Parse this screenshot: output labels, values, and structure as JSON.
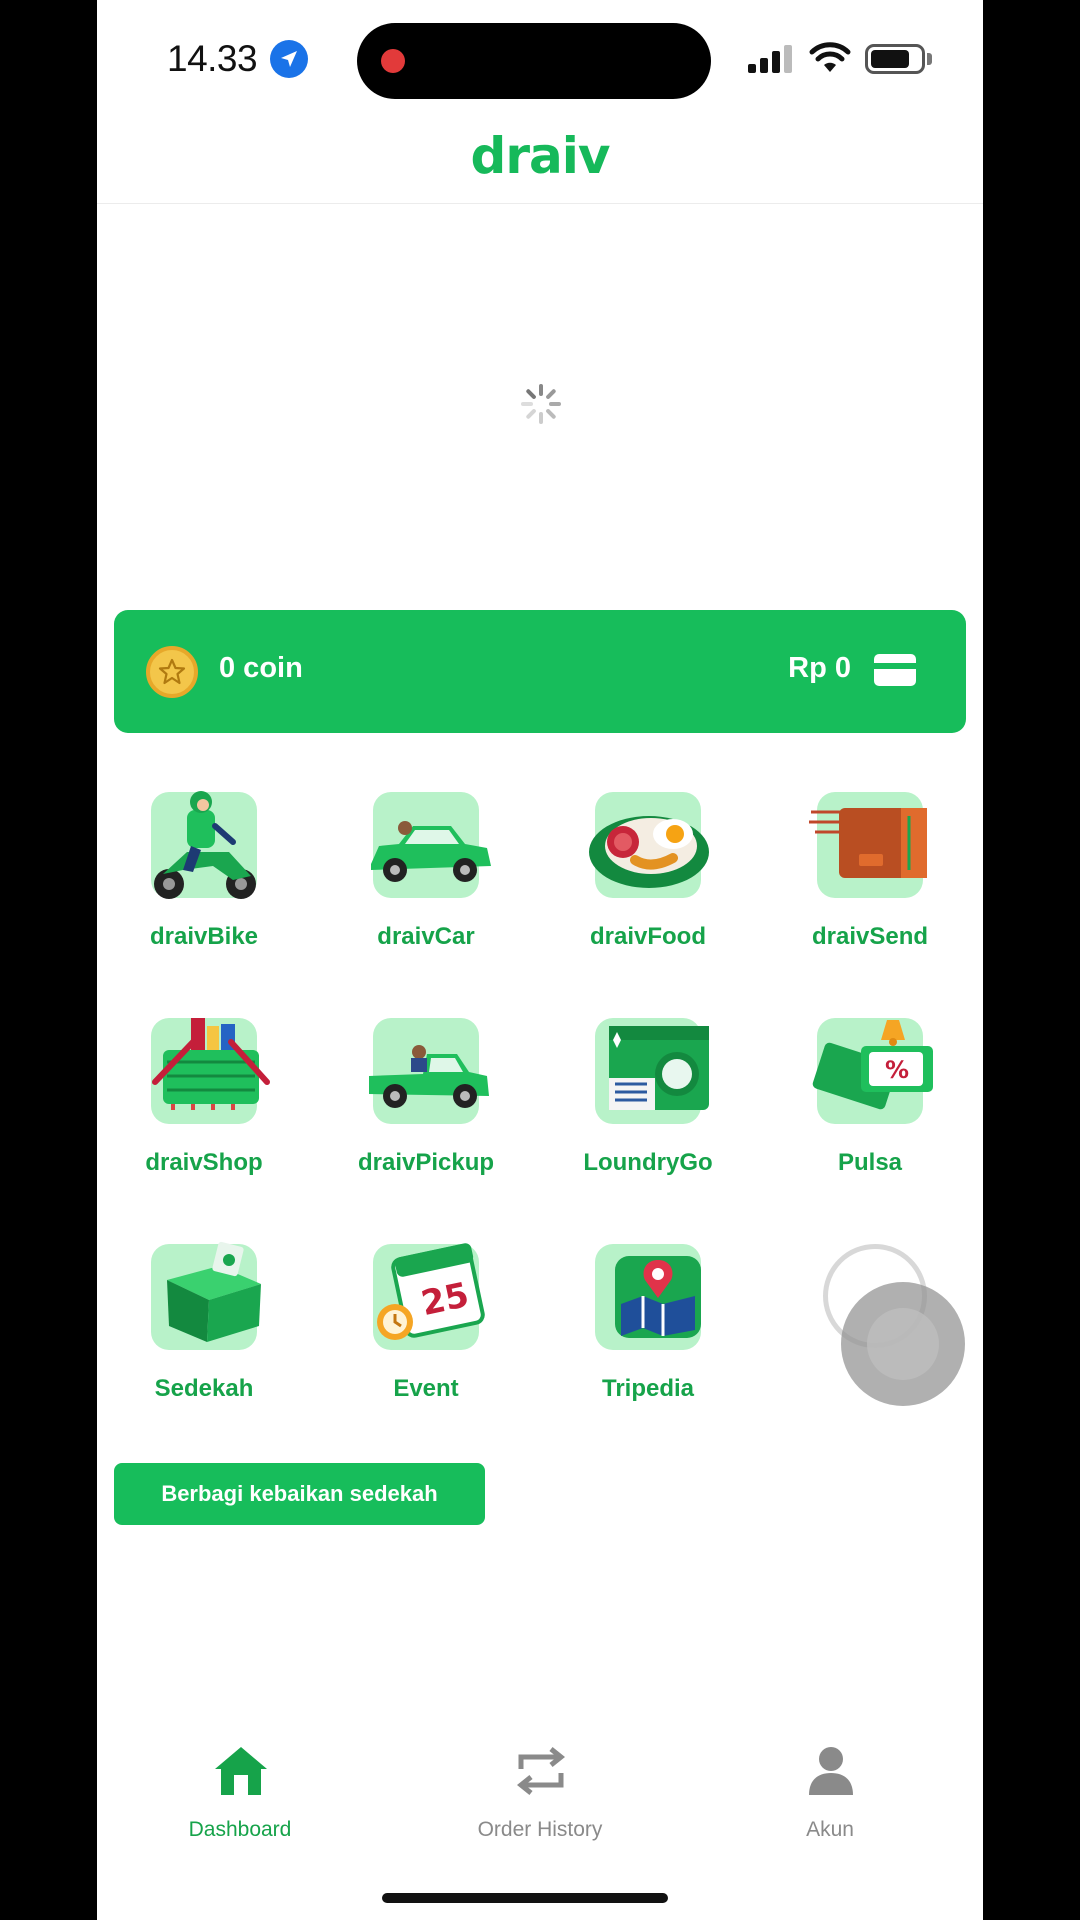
{
  "status_bar": {
    "time": "14.33",
    "location_icon": "location-arrow-icon",
    "signal_icon": "cellular-signal-icon",
    "wifi_icon": "wifi-icon",
    "battery_icon": "battery-icon"
  },
  "header": {
    "logo": "draiv"
  },
  "banner": {
    "loading_icon": "loading-spinner-icon"
  },
  "wallet": {
    "coin_label": "0 coin",
    "balance_label": "Rp 0",
    "coin_icon": "coin-star-icon",
    "card_icon": "credit-card-icon"
  },
  "services": [
    {
      "label": "draivBike",
      "icon": "motorbike-icon"
    },
    {
      "label": "draivCar",
      "icon": "car-icon"
    },
    {
      "label": "draivFood",
      "icon": "food-plate-icon"
    },
    {
      "label": "draivSend",
      "icon": "package-icon"
    },
    {
      "label": "draivShop",
      "icon": "shopping-basket-icon"
    },
    {
      "label": "draivPickup",
      "icon": "pickup-truck-icon"
    },
    {
      "label": "LoundryGo",
      "icon": "washing-machine-icon"
    },
    {
      "label": "Pulsa",
      "icon": "voucher-icon"
    },
    {
      "label": "Sedekah",
      "icon": "donation-box-icon"
    },
    {
      "label": "Event",
      "icon": "calendar-icon"
    },
    {
      "label": "Tripedia",
      "icon": "map-pin-icon"
    }
  ],
  "cta": {
    "label": "Berbagi kebaikan sedekah"
  },
  "bottom_nav": [
    {
      "label": "Dashboard",
      "icon": "home-icon",
      "active": true
    },
    {
      "label": "Order History",
      "icon": "repeat-icon",
      "active": false
    },
    {
      "label": "Akun",
      "icon": "user-icon",
      "active": false
    }
  ],
  "colors": {
    "brand": "#17bd5b",
    "brand_text": "#16a34a",
    "tile_bg": "#b8f2c9",
    "inactive_nav": "#8a8a8a"
  }
}
